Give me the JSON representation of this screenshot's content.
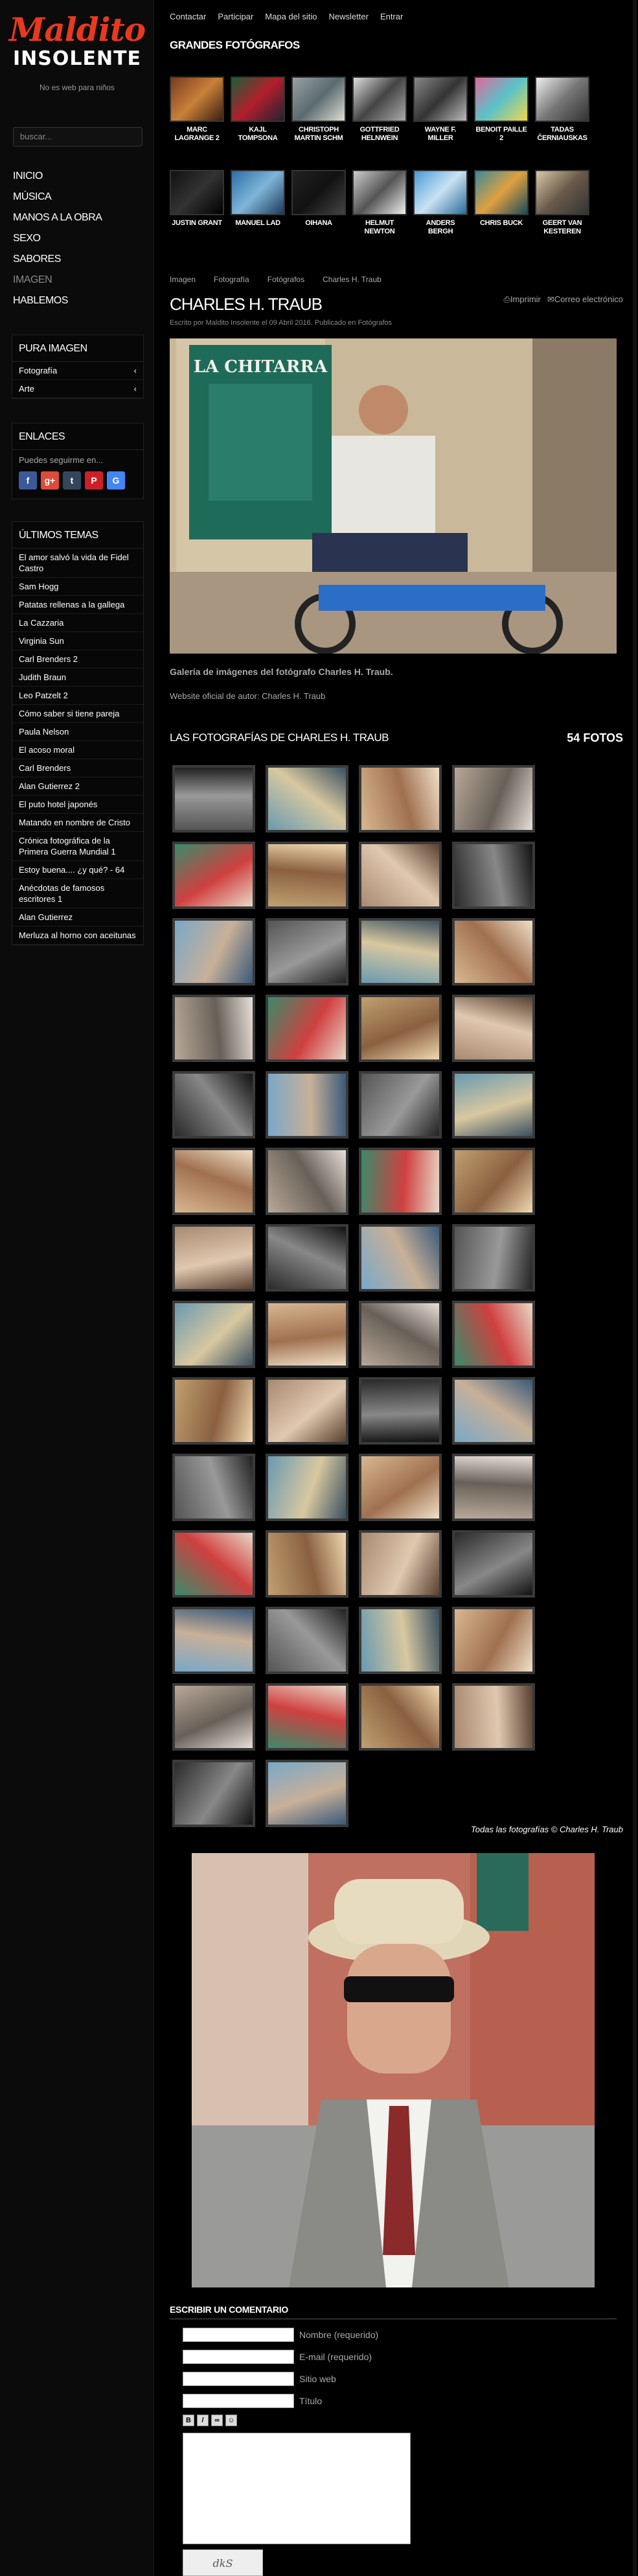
{
  "site": {
    "logo_line1": "Maldito",
    "logo_line2": "INSOLENTE",
    "tagline": "No es web para niños"
  },
  "search": {
    "placeholder": "buscar..."
  },
  "menu": [
    "INICIO",
    "MÚSICA",
    "MANOS A LA OBRA",
    "SEXO",
    "SABORES",
    "IMAGEN",
    "HABLEMOS"
  ],
  "widgets": {
    "pura_imagen": {
      "title": "PURA IMAGEN",
      "items": [
        "Fotografía",
        "Arte"
      ]
    },
    "enlaces": {
      "title": "ENLACES",
      "text": "Puedes seguirme en..."
    },
    "ultimos": {
      "title": "ÚLTIMOS TEMAS",
      "items": [
        "El amor salvó la vida de Fidel Castro",
        "Sam Hogg",
        "Patatas rellenas a la gallega",
        "La Cazzaria",
        "Virginia Sun",
        "Carl Brenders 2",
        "Judith Braun",
        "Leo Patzelt 2",
        "Cómo saber si tiene pareja",
        "Paula Nelson",
        "El acoso moral",
        "Carl Brenders",
        "Alan Gutierrez 2",
        "El puto hotel japonés",
        "Matando en nombre de Cristo",
        "Crónica fotográfica de la Primera Guerra Mundial 1",
        "Estoy buena.... ¿y qué? - 64",
        "Anécdotas de famosos escritores 1",
        "Alan Gutierrez",
        "Merluza al horno con aceitunas"
      ]
    }
  },
  "topnav": [
    "Contactar",
    "Participar",
    "Mapa del sitio",
    "Newsletter",
    "Entrar"
  ],
  "grandes": {
    "title": "GRANDES FOTÓGRAFOS",
    "row1": [
      "MARC LAGRANGE 2",
      "KAJL TOMPSONA",
      "CHRISTOPH MARTIN SCHM",
      "GOTTFRIED HELNWEIN",
      "WAYNE F. MILLER",
      "BENOIT PAILLE 2",
      "TADAS ČERNIAUSKAS"
    ],
    "row2": [
      "JUSTIN GRANT",
      "MANUEL LAD",
      "OIHANA",
      "HELMUT NEWTON",
      "ANDERS BERGH",
      "CHRIS BUCK",
      "GEERT VAN KESTEREN"
    ]
  },
  "breadcrumb": [
    "Imagen",
    "Fotografía",
    "Fotógrafos",
    "Charles H. Traub"
  ],
  "article": {
    "title": "CHARLES H. TRAUB",
    "print": "Imprimir",
    "email": "Correo electrónico",
    "byline": "Escrito por Maldito Insolente el 09 Abril 2016. Publicado en Fotógrafos",
    "hero_sign": "LA CHITARRA",
    "caption": "Galería de imágenes del fotógrafo Charles H. Traub.",
    "official": "Website oficial de autor: Charles H. Traub"
  },
  "gallery": {
    "title": "LAS FOTOGRAFÍAS DE CHARLES H. TRAUB",
    "count": "54 FOTOS",
    "credit": "Todas las fotografías © Charles H. Traub"
  },
  "comment": {
    "title": "ESCRIBIR UN COMENTARIO",
    "fields": [
      "Nombre (requerido)",
      "E-mail (requerido)",
      "Sitio web",
      "Título"
    ],
    "captcha": "dkS"
  },
  "colors": {
    "logo_red": "#e8391f",
    "facebook": "#3b5998",
    "google": "#dd4b39",
    "tumblr": "#35465c",
    "pinterest": "#cb2027",
    "google_blue": "#4285f4"
  }
}
